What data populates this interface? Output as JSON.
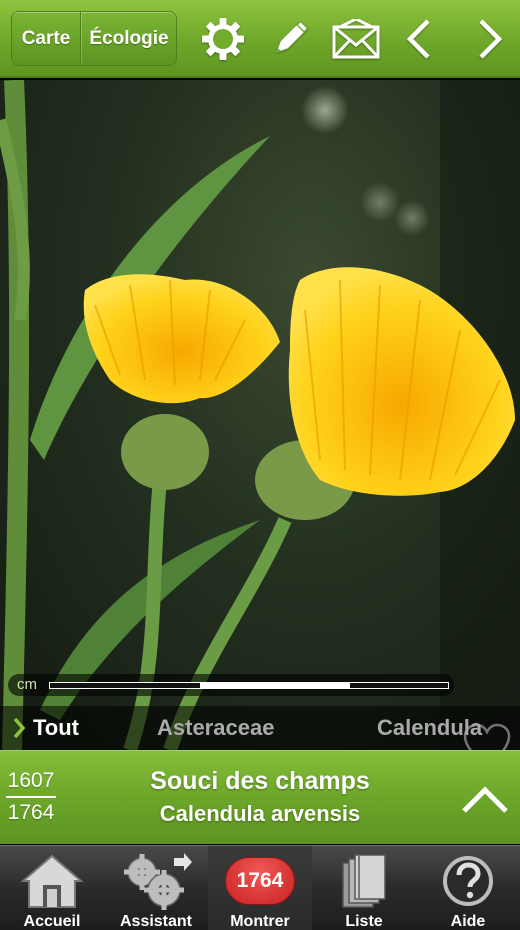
{
  "topbar": {
    "tab_map": "Carte",
    "tab_ecology": "Écologie",
    "icons": [
      "gear-icon",
      "pencil-icon",
      "envelope-icon",
      "chevron-left-icon",
      "chevron-right-icon"
    ]
  },
  "photo": {
    "scale_unit": "cm",
    "favorite_icon": "heart-outline-icon"
  },
  "breadcrumb": {
    "items": [
      "Tout",
      "Asteraceae",
      "Calendula"
    ]
  },
  "species": {
    "position": "1607",
    "total": "1764",
    "common_name": "Souci des champs",
    "latin_name": "Calendula arvensis",
    "expand_icon": "chevron-up-icon"
  },
  "tabbar": {
    "tabs": [
      {
        "label": "Accueil",
        "icon": "home-icon"
      },
      {
        "label": "Assistant",
        "icon": "gears-icon"
      },
      {
        "label": "Montrer",
        "badge": "1764",
        "active": true
      },
      {
        "label": "Liste",
        "icon": "books-icon"
      },
      {
        "label": "Aide",
        "icon": "help-icon"
      }
    ]
  },
  "colors": {
    "brand_green": "#6fa72a",
    "badge_red": "#d52a28"
  }
}
